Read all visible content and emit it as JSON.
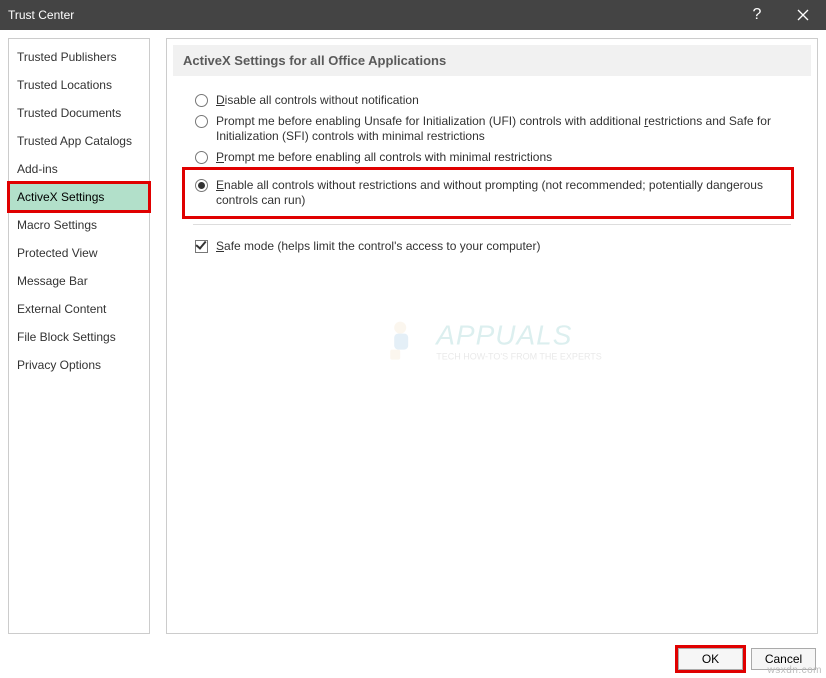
{
  "window": {
    "title": "Trust Center"
  },
  "sidebar": {
    "items": [
      {
        "label": "Trusted Publishers"
      },
      {
        "label": "Trusted Locations"
      },
      {
        "label": "Trusted Documents"
      },
      {
        "label": "Trusted App Catalogs"
      },
      {
        "label": "Add-ins"
      },
      {
        "label": "ActiveX Settings"
      },
      {
        "label": "Macro Settings"
      },
      {
        "label": "Protected View"
      },
      {
        "label": "Message Bar"
      },
      {
        "label": "External Content"
      },
      {
        "label": "File Block Settings"
      },
      {
        "label": "Privacy Options"
      }
    ],
    "selected_index": 5
  },
  "main": {
    "section_title": "ActiveX Settings for all Office Applications",
    "radios": [
      {
        "pre": "",
        "accel": "D",
        "rest": "isable all controls without notification"
      },
      {
        "pre": "Prompt me before enabling Unsafe for Initialization (UFI) controls with additional ",
        "accel": "r",
        "rest": "estrictions and Safe for Initialization (SFI) controls with minimal restrictions"
      },
      {
        "pre": "",
        "accel": "P",
        "rest": "rompt me before enabling all controls with minimal restrictions"
      },
      {
        "pre": "",
        "accel": "E",
        "rest": "nable all controls without restrictions and without prompting (not recommended; potentially dangerous controls can run)"
      }
    ],
    "selected_radio": 3,
    "checkbox": {
      "pre": "",
      "accel": "S",
      "rest": "afe mode (helps limit the control's access to your computer)",
      "checked": true
    }
  },
  "buttons": {
    "ok": "OK",
    "cancel": "Cancel"
  },
  "watermark": {
    "text": "APPUALS",
    "sub": "TECH HOW-TO'S FROM THE EXPERTS"
  },
  "credit": "wsxdn.com"
}
